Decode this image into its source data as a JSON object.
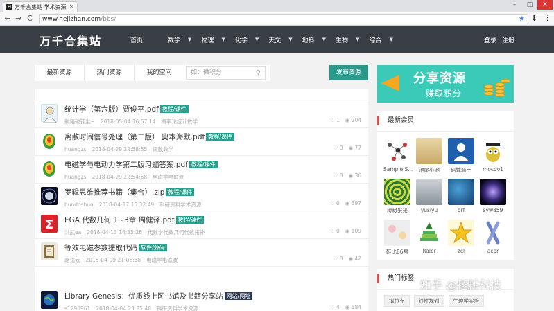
{
  "browser": {
    "tab_title": "万千合集站 学术资源综合",
    "tab_close": "×",
    "favicon_letter": "H",
    "window_controls": [
      "–",
      "□",
      "✕"
    ],
    "back": "←",
    "forward": "→",
    "reload": "C",
    "url_domain": "www.hejizhan.com",
    "url_path": "/bbs/",
    "star": "★",
    "download": "⬇",
    "menu": "⋮"
  },
  "site": {
    "logo": "万千合集站",
    "nav": [
      {
        "label": "首页",
        "has_dropdown": false
      },
      {
        "label": "数学",
        "has_dropdown": true
      },
      {
        "label": "物理",
        "has_dropdown": true
      },
      {
        "label": "化学",
        "has_dropdown": true
      },
      {
        "label": "天文",
        "has_dropdown": true
      },
      {
        "label": "地科",
        "has_dropdown": true
      },
      {
        "label": "生物",
        "has_dropdown": true
      },
      {
        "label": "综合",
        "has_dropdown": true
      }
    ],
    "caret": "▼",
    "login": "登录",
    "register": "注册"
  },
  "tabs": [
    "最新资源",
    "热门资源",
    "我的空间"
  ],
  "search": {
    "placeholder": "如：微积分",
    "icon": "search-icon"
  },
  "publish_button": "发布资源",
  "posts": [
    {
      "title": "统计学（第六版）贾俊平.pdf",
      "tag": "教程/课件",
      "tag_style": "green",
      "user": "航箱破钝尘~",
      "time": "2018-05-04 16:57:14",
      "category": "概率论统计数学",
      "likes": "1",
      "views": "204",
      "thumb": "person"
    },
    {
      "title": "离散时间信号处理（第二版） 奥本海默.pdf",
      "tag": "教程/课件",
      "tag_style": "green",
      "user": "huangzs",
      "time": "2018-04-29 22:58:55",
      "category": "离散数学",
      "likes": "0",
      "views": "77",
      "thumb": "plot"
    },
    {
      "title": "电磁学与电动力学第二版习题答案.pdf",
      "tag": "教程/课件",
      "tag_style": "green",
      "user": "huangzs",
      "time": "2018-04-29 22:54:58",
      "category": "电磁学电磁波",
      "likes": "0",
      "views": "36",
      "thumb": "plot"
    },
    {
      "title": "罗辑思维推荐书籍（集合）.zip",
      "tag": "教程/课件",
      "tag_style": "green",
      "user": "hundoshuo",
      "time": "2018-04-17 15:32:49",
      "category": "科研资料学术资源",
      "likes": "0",
      "views": "397",
      "thumb": "space"
    },
    {
      "title": "EGA 代数几何 1~3章 周健译.pdf",
      "tag": "教程/课件",
      "tag_style": "green",
      "user": "洪武ea",
      "time": "2018-04-13 14:33:26",
      "category": "代数学代数几何代数拓扑",
      "likes": "0",
      "views": "109",
      "thumb": "sigma"
    },
    {
      "title": "等效电磁参数提取代码",
      "tag": "软件/源码",
      "tag_style": "green",
      "user": "路铭云",
      "time": "2018-04-09 21:08:58",
      "category": "电磁学电磁波",
      "likes": "0",
      "views": "42",
      "thumb": "book"
    },
    {
      "title": "Library Genesis：优质线上图书馆及书籍分享站",
      "tag": "网站/网址",
      "tag_style": "dark",
      "user": "s1290961",
      "time": "2018-04-04 23:35:48",
      "category": "科研资料学术资源",
      "likes": "4",
      "views": "184",
      "thumb": "globe"
    }
  ],
  "banner": {
    "line1": "分享资源",
    "line2": "赚取积分"
  },
  "members_section": {
    "title": "最新会员",
    "members": [
      {
        "name": "Sample.S...",
        "avatar": "molecule"
      },
      {
        "name": "池尾小池",
        "avatar": "sand"
      },
      {
        "name": "码蛛骑士",
        "avatar": "doctor"
      },
      {
        "name": "mocoo1",
        "avatar": "owl"
      },
      {
        "name": "梭梭米米",
        "avatar": "spiral"
      },
      {
        "name": "yusiyu",
        "avatar": "room"
      },
      {
        "name": "brf",
        "avatar": "earth"
      },
      {
        "name": "syw859",
        "avatar": "galaxy"
      },
      {
        "name": "鞋比86号",
        "avatar": "flowers"
      },
      {
        "name": "Raler",
        "avatar": "books"
      },
      {
        "name": "zcl",
        "avatar": "star"
      },
      {
        "name": "acer",
        "avatar": "chromosome"
      }
    ]
  },
  "tags_section": {
    "title": "热门标签",
    "tags": [
      "拟拉克",
      "线性规划",
      "生理学实验"
    ]
  },
  "watermark": "知乎 @稻耕科技",
  "colors": {
    "header_bg": "#3a3e45",
    "accent": "#2b9a8c",
    "banner": "#3ccab8",
    "section_marker": "#d9534f"
  }
}
